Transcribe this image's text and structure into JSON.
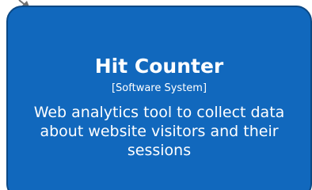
{
  "system": {
    "name": "Hit Counter",
    "type": "[Software System]",
    "description": "Web analytics tool to collect data about website visitors and their sessions"
  },
  "colors": {
    "box_fill": "#1168bd",
    "box_border": "#0b4884",
    "text": "#ffffff",
    "connector": "#707070"
  }
}
